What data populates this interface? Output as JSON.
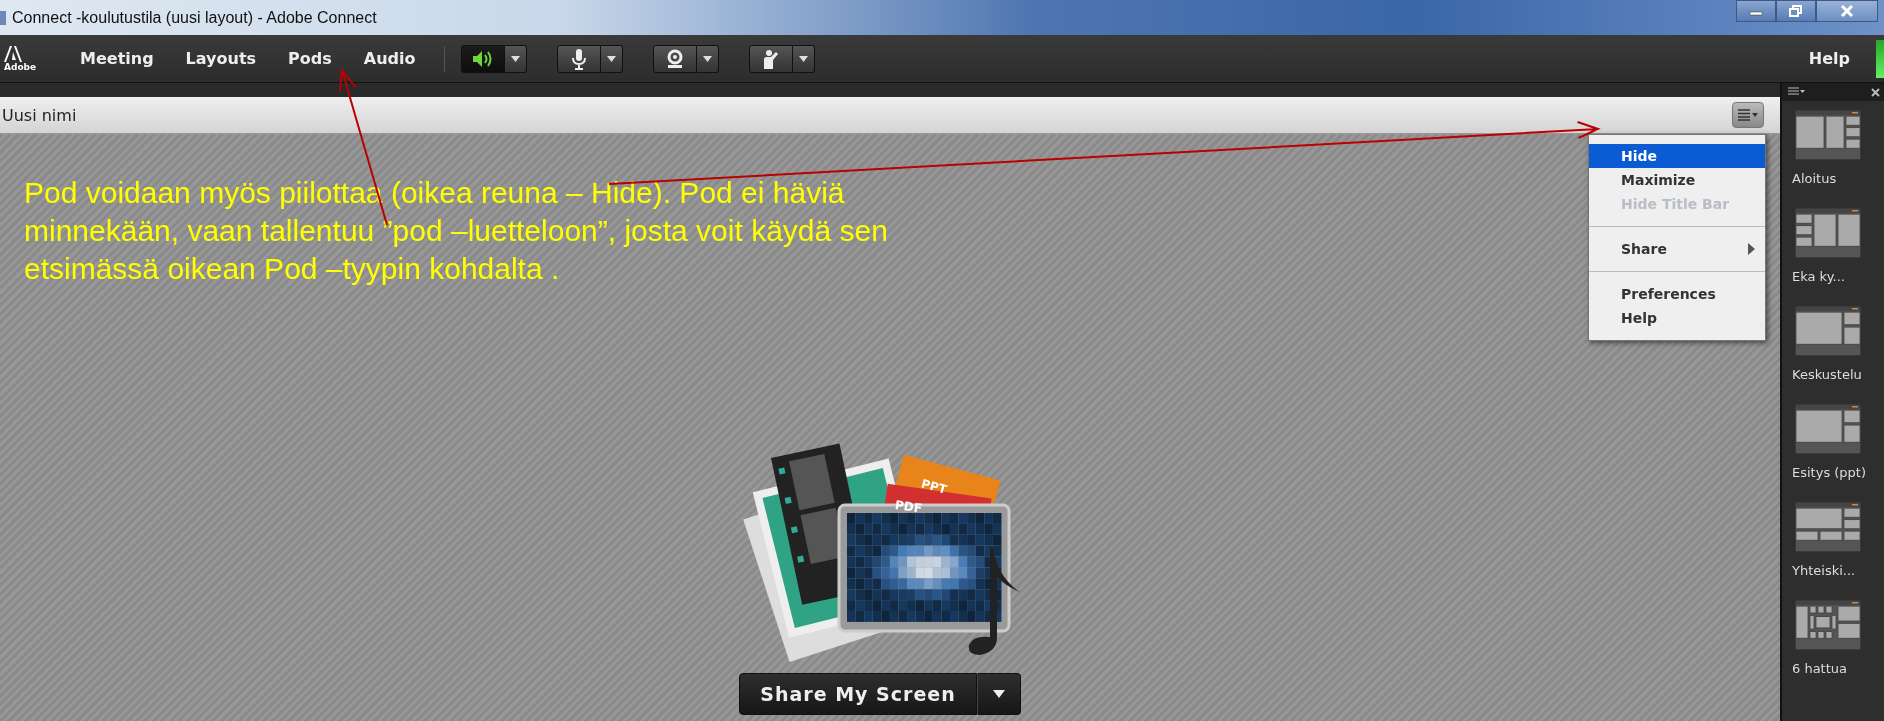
{
  "window": {
    "title": "Connect -koulutustila (uusi layout) - Adobe Connect"
  },
  "toolbar": {
    "logo_text": "Adobe",
    "menus": [
      "Meeting",
      "Layouts",
      "Pods",
      "Audio"
    ],
    "controls": [
      {
        "kind": "speaker",
        "on": true
      },
      {
        "kind": "microphone",
        "on": false
      },
      {
        "kind": "camera",
        "on": false
      },
      {
        "kind": "hand",
        "on": false
      }
    ],
    "help": "Help"
  },
  "pod": {
    "title": "Uusi nimi",
    "annotation": "Pod voidaan myös piilottaa (oikea reuna – Hide).  Pod ei häviä minnekään, vaan  tallentuu ”pod –luetteloon”, josta voit käydä sen etsimässä  oikean Pod –tyypin kohdalta .",
    "file_labels": [
      "PPT",
      "PDF"
    ],
    "share_button": "Share My Screen"
  },
  "pod_menu": {
    "groups": [
      [
        {
          "label": "Hide",
          "selected": true,
          "disabled": false,
          "submenu": false
        },
        {
          "label": "Maximize",
          "selected": false,
          "disabled": false,
          "submenu": false
        },
        {
          "label": "Hide Title Bar",
          "selected": false,
          "disabled": true,
          "submenu": false
        }
      ],
      [
        {
          "label": "Share",
          "selected": false,
          "disabled": false,
          "submenu": true
        }
      ],
      [
        {
          "label": "Preferences",
          "selected": false,
          "disabled": false,
          "submenu": false
        },
        {
          "label": "Help",
          "selected": false,
          "disabled": false,
          "submenu": false
        }
      ]
    ]
  },
  "layouts": [
    {
      "name": "Aloitus",
      "kind": "center-column"
    },
    {
      "name": "Eka ky...",
      "kind": "three-column"
    },
    {
      "name": "Keskustelu",
      "kind": "main-side"
    },
    {
      "name": "Esitys (ppt)",
      "kind": "main-side"
    },
    {
      "name": "Yhteiski...",
      "kind": "main-bottom"
    },
    {
      "name": "6 hattua",
      "kind": "grid"
    }
  ]
}
